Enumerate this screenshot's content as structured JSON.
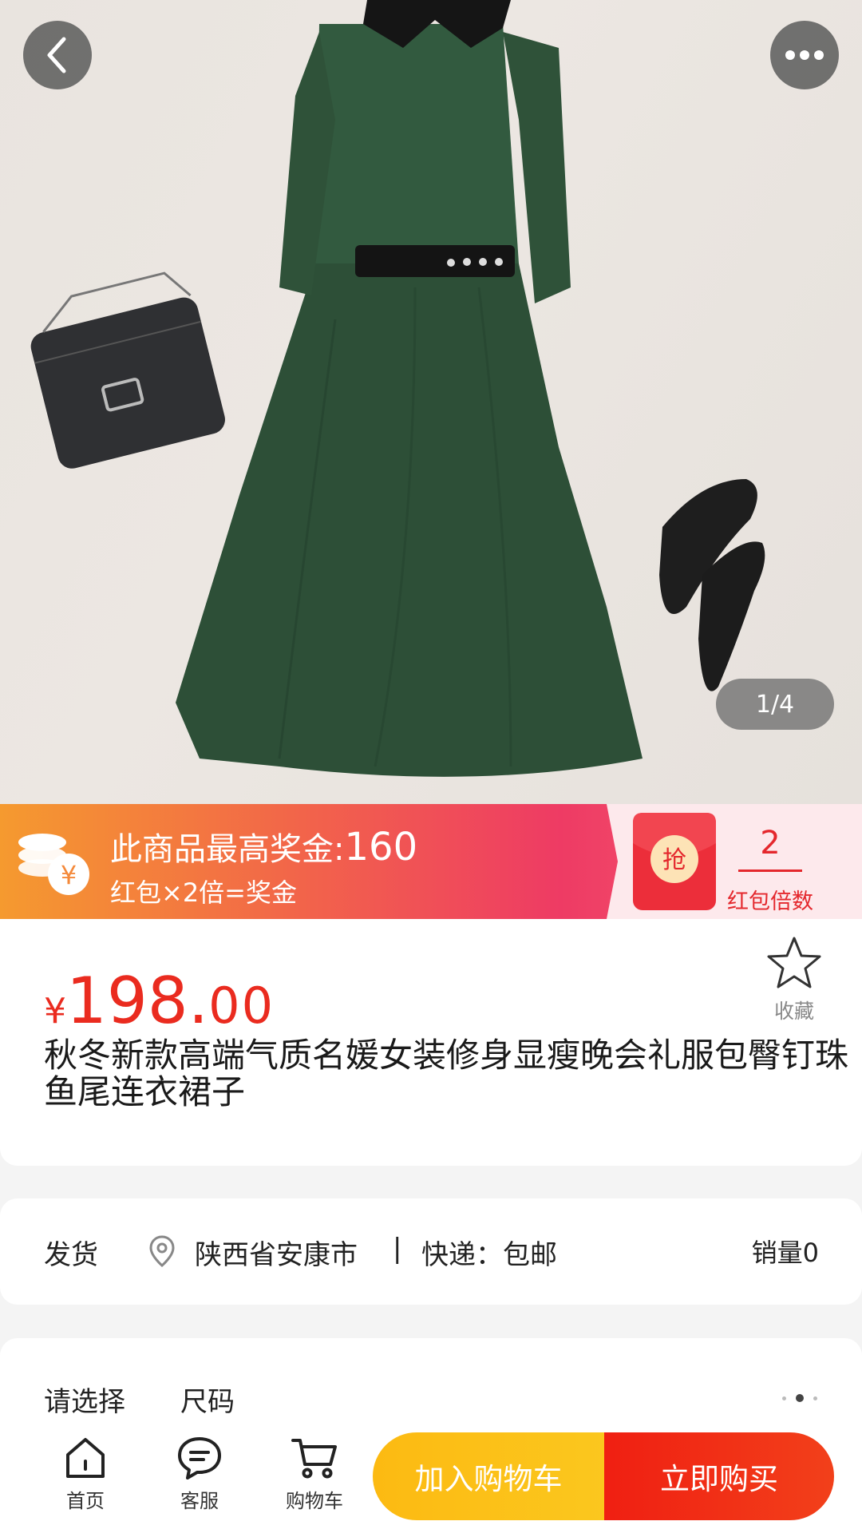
{
  "product_images": {
    "current_page": 1,
    "total_pages": 4,
    "indicator_text": "1/4",
    "image_description_icon": "product-photo-icon"
  },
  "header": {
    "back_icon": "chevron-left-icon",
    "more_icon": "more-dots-icon"
  },
  "bonus_banner": {
    "title_prefix": "此商品最高奖金:",
    "max_bonus": "160",
    "subtitle": "红包×2倍=奖金",
    "grab_label": "抢",
    "multiplier": "2",
    "multiplier_label": "红包倍数",
    "coins_icon": "yuan-coins-icon"
  },
  "product": {
    "currency_symbol": "¥",
    "price_integer": "198.",
    "price_decimal": "00",
    "title": "秋冬新款高端气质名媛女装修身显瘦晚会礼服包臀钉珠鱼尾连衣裙子",
    "favorite_label": "收藏"
  },
  "shipping": {
    "label": "发货",
    "origin": "陕西省安康市",
    "separator": "|",
    "delivery": "快递：包邮",
    "sales": "销量0"
  },
  "selection": {
    "label": "请选择",
    "value": "尺码"
  },
  "bottom_nav": {
    "home": "首页",
    "service": "客服",
    "cart": "购物车",
    "add_to_cart": "加入购物车",
    "buy_now": "立即购买"
  },
  "colors": {
    "price_red": "#ea2b1f",
    "cart_yellow": "#fcba12",
    "buy_red": "#f01f12",
    "dress_green": "#2d4f37"
  }
}
